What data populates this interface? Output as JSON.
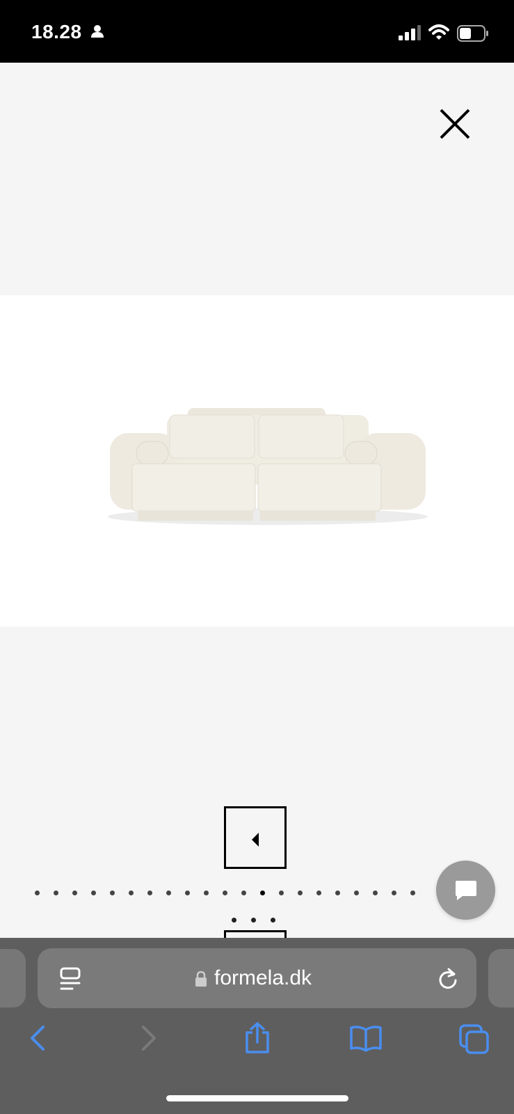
{
  "status_bar": {
    "time": "18.28",
    "icons": [
      "person-icon",
      "signal-icon",
      "wifi-icon",
      "battery-icon"
    ]
  },
  "gallery": {
    "close_icon": "close-icon",
    "image_alt": "sofa product image",
    "total_slides": 21,
    "active_slide": 13,
    "chat_icon": "chat-bubble-icon"
  },
  "browser": {
    "url": "formela.dk",
    "icons": [
      "reader-icon",
      "lock-icon",
      "reload-icon",
      "back-icon",
      "forward-icon",
      "share-icon",
      "bookmarks-icon",
      "tabs-icon"
    ],
    "accent": "#4a8ef0"
  }
}
